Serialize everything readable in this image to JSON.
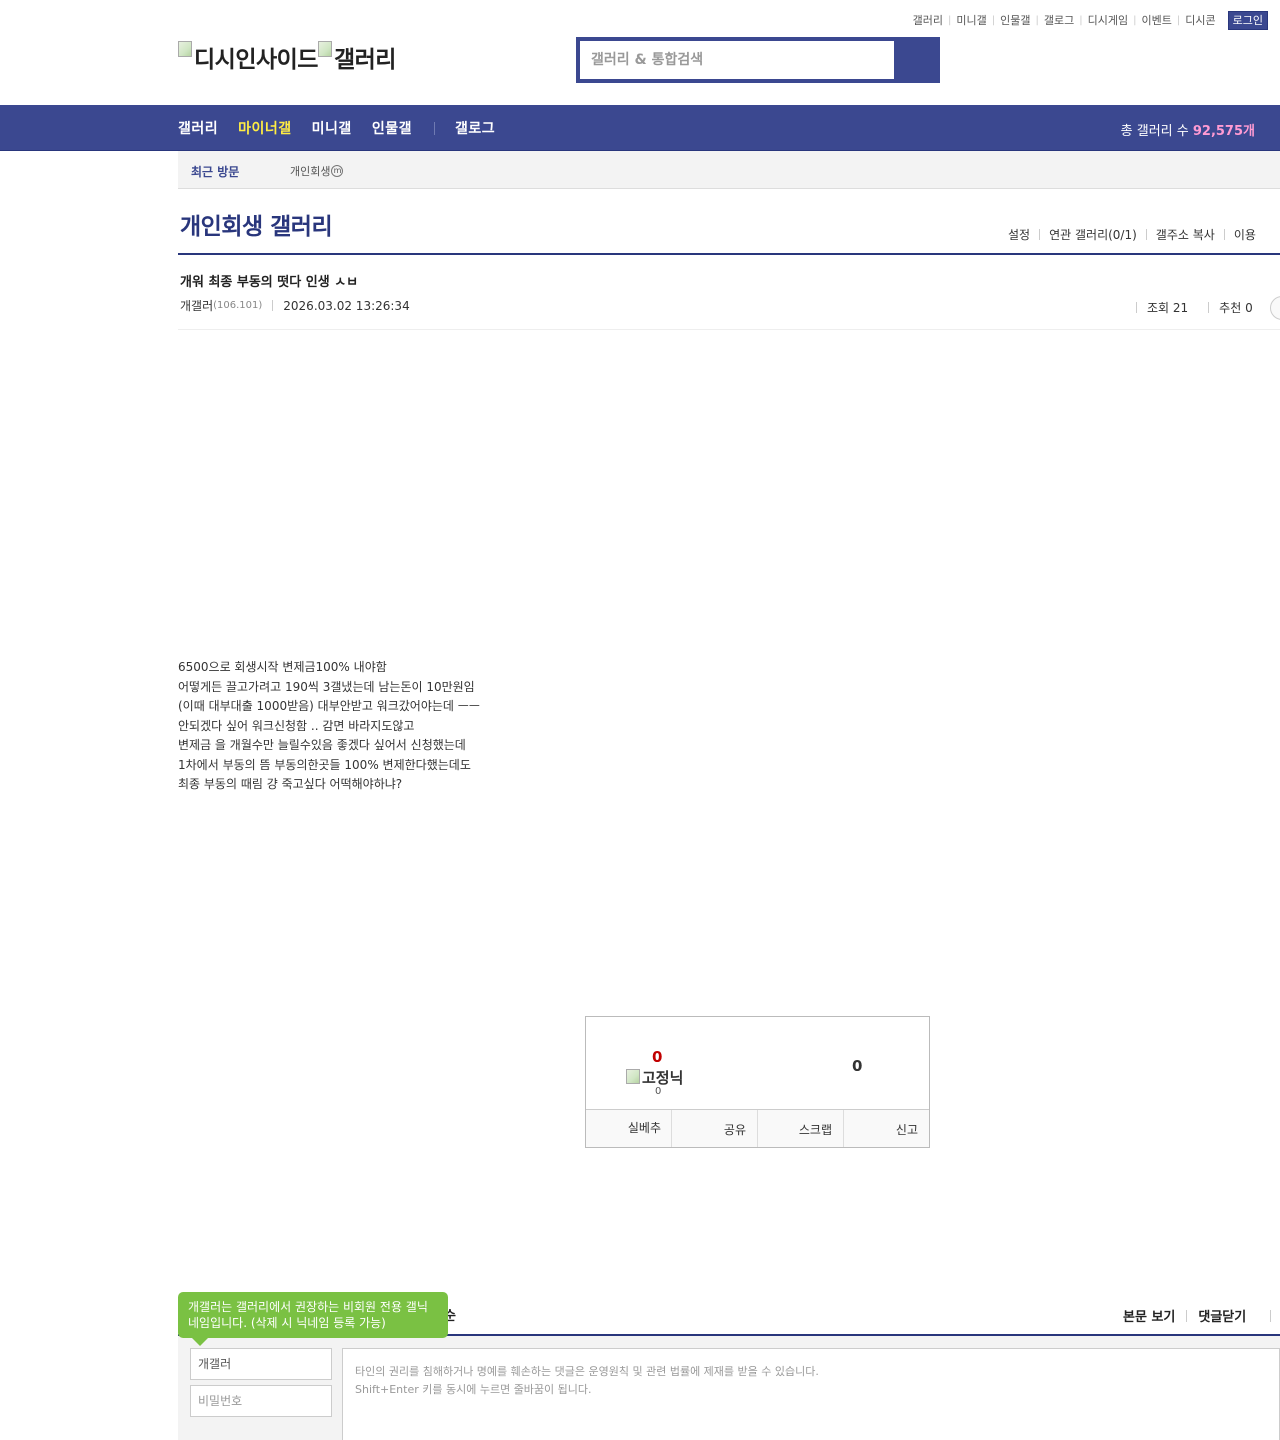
{
  "top_links": [
    "갤러리",
    "미니갤",
    "인물갤",
    "갤로그",
    "디시게임",
    "이벤트",
    "디시콘"
  ],
  "login_label": "로그인",
  "logo": {
    "alt1": "디시인사이드",
    "alt2": "갤러리"
  },
  "search": {
    "placeholder": "갤러리 & 통합검색"
  },
  "nav": {
    "items": [
      "갤러리",
      "마이너갤",
      "미니갤",
      "인물갤"
    ],
    "extra": "갤로그",
    "total_label": "총 갤러리 수",
    "total_value": "92,575개"
  },
  "recent": {
    "title": "최근 방문",
    "item": "개인회생",
    "badge": "m"
  },
  "gallery": {
    "title": "개인회생 갤러리",
    "menu": [
      "설정",
      "연관 갤러리(0/1)",
      "갤주소 복사",
      "이용"
    ]
  },
  "post": {
    "title": "개워 최종 부동의 떳다 인생 ㅅㅂ",
    "author": "개갤러",
    "ip": "(106.101)",
    "date": "2026.03.02 13:26:34",
    "views_label": "조회 21",
    "recommend_label": "추천 0",
    "body": [
      "6500으로 회생시작 변제금100% 내야함",
      "어떻게든 끌고가려고 190씩 3갤냈는데 남는돈이 10만원임",
      "(이때 대부대출 1000받음) 대부안받고 워크갔어야는데 ㅡㅡ",
      "안되겠다 싶어 워크신청함 .. 감면 바라지도않고",
      "변제금 을 개월수만 늘릴수있음 좋겠다 싶어서 신청했는데",
      "1차에서 부동의 뜸 부동의한곳들 100% 변제한다했는데도",
      "최종 부동의 때림 걍 죽고싶다 어떡해야하냐?"
    ]
  },
  "recommend_box": {
    "up_count": "0",
    "fixed_nick_alt": "고정닉",
    "fixed_count": "0",
    "down_count": "0",
    "buttons": [
      "실베추",
      "공유",
      "스크랩",
      "신고"
    ]
  },
  "comments": {
    "peek": "순",
    "view_body": "본문 보기",
    "close_comments": "댓글닫기",
    "tooltip": "개갤러는 갤러리에서 권장하는 비회원 전용 갤닉네임입니다. (삭제 시 닉네임 등록 가능)",
    "name_value": "개갤러",
    "password_placeholder": "비밀번호",
    "textarea_line1": "타인의 권리를 침해하거나 명예를 훼손하는 댓글은 운영원칙 및 관련 법률에 제재를 받을 수 있습니다.",
    "textarea_line2": "Shift+Enter 키를 동시에 누르면 줄바꿈이 됩니다."
  },
  "colors": {
    "brand": "#3b4890",
    "brand_dark": "#29367c",
    "active_nav": "#ffed43",
    "count": "#ff9bd3",
    "tooltip": "#7ac143",
    "up": "#c10000"
  }
}
